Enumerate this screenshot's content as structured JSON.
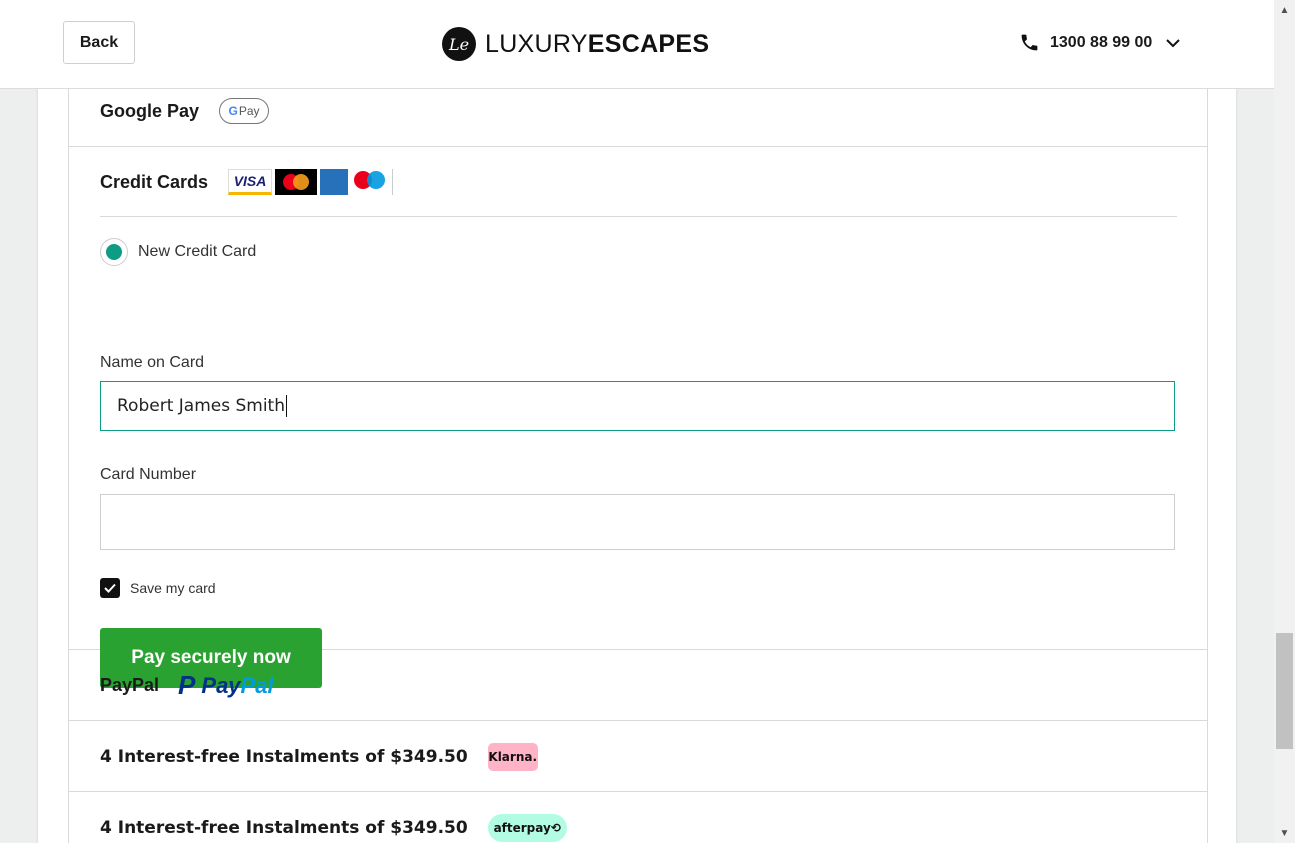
{
  "header": {
    "back_label": "Back",
    "logo_mark": "Le",
    "logo_light": "LUXURY",
    "logo_bold": "ESCAPES",
    "phone": "1300 88 99 00"
  },
  "payment": {
    "google_pay": {
      "label": "Google Pay",
      "badge_g": "G",
      "badge_text": "Pay"
    },
    "credit_cards": {
      "label": "Credit Cards",
      "logos": {
        "visa": "VISA"
      },
      "option_label": "New Credit Card",
      "name_label": "Name on Card",
      "name_value": "Robert James Smith",
      "number_label": "Card Number",
      "number_value": "",
      "save_label": "Save my card",
      "save_checked": true,
      "pay_button": "Pay securely now"
    },
    "paypal": {
      "label": "PayPal",
      "logo_pay": "Pay",
      "logo_pal": "Pal"
    },
    "klarna": {
      "label": "4 Interest-free Instalments of $349.50",
      "badge": "Klarna."
    },
    "afterpay": {
      "label": "4 Interest-free Instalments of $349.50",
      "badge": "afterpay⟲"
    }
  },
  "colors": {
    "accent_green": "#2aa231",
    "teal": "#0e9c84",
    "klarna_pink": "#ffb3c7",
    "afterpay_mint": "#b2fce4"
  }
}
